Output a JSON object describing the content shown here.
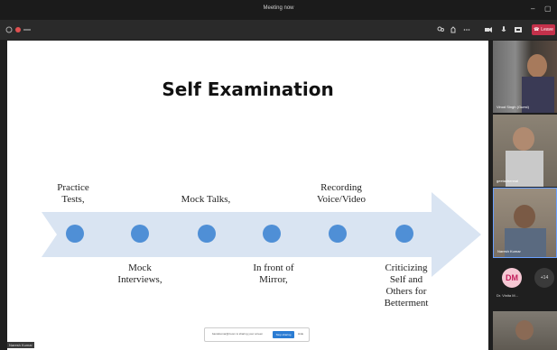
{
  "window": {
    "title": "Meeting now",
    "controls": {
      "minimize": "–",
      "restore": "▢"
    }
  },
  "toolbar": {
    "leave_label": "Leave"
  },
  "slide": {
    "title": "Self Examination",
    "upper_labels": [
      "Practice Tests,",
      "Mock Talks,",
      "Recording Voice/Video"
    ],
    "lower_labels": [
      "Mock Interviews,",
      "In front of Mirror,",
      "Criticizing Self and Others for Betterment"
    ]
  },
  "share_bar": {
    "text": "bansikumar@zoom is sharing your screen",
    "stop_label": "Stop sharing",
    "hide_label": "Hide"
  },
  "presenter_label": "Naresh Kumar",
  "participants": [
    {
      "name": "Vinod Singh (Guest)"
    },
    {
      "name": "geetachennai"
    },
    {
      "name": "Naresh Kumar"
    }
  ],
  "extra": {
    "initials": "DM",
    "name": "Dr. Vinita M...",
    "more_count": "+14"
  },
  "colors": {
    "accent_blue": "#4f8fd6",
    "arrow": "#d9e4f2",
    "leave": "#c4314b"
  }
}
